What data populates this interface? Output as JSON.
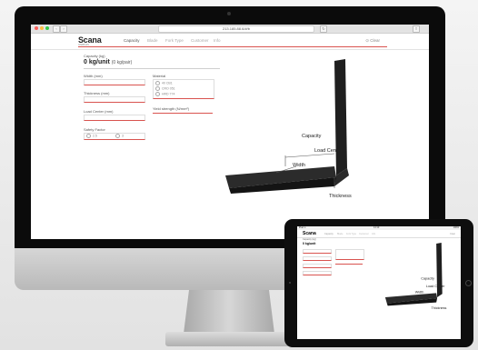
{
  "browser": {
    "url": "213.185.88.6/#/b",
    "back_label": "‹",
    "forward_label": "›"
  },
  "app": {
    "logo": "Scana",
    "logo_subtitle": "UNIPLAN",
    "tabs": [
      {
        "label": "Capacity",
        "active": true
      },
      {
        "label": "Blade"
      },
      {
        "label": "Fork Type"
      },
      {
        "label": "Customer"
      },
      {
        "label": "Info"
      }
    ],
    "clear_label": "Clear",
    "accent_color": "#d9534f"
  },
  "form": {
    "capacity_label": "Capacity (kg)",
    "capacity_value": "0 kg/unit",
    "capacity_pair": "(0 kg/pair)",
    "width_label": "Width (mm)",
    "thickness_label": "Thickness (mm)",
    "load_center_label": "Load Center (mm)",
    "safety_factor_label": "Safety Factor",
    "safety_options": [
      "2.5",
      "3"
    ],
    "material_label": "Material",
    "material_options": [
      "40 CB1",
      "CRO 051",
      "HRD 774"
    ],
    "yield_label": "Yield strength (N/mm²)"
  },
  "diagram": {
    "capacity_label": "Capacity",
    "load_center_label": "Load Center",
    "width_label": "Width",
    "thickness_label": "Thickness"
  },
  "ipad": {
    "status_left": "iPad ✈",
    "status_time": "14:10",
    "status_right": "100%",
    "logo": "Scana",
    "capacity_value": "0 kg/unit"
  },
  "icons": [
    "close-dot-icon",
    "minimize-dot-icon",
    "zoom-dot-icon",
    "radio-icon",
    "reload-icon",
    "share-icon"
  ]
}
